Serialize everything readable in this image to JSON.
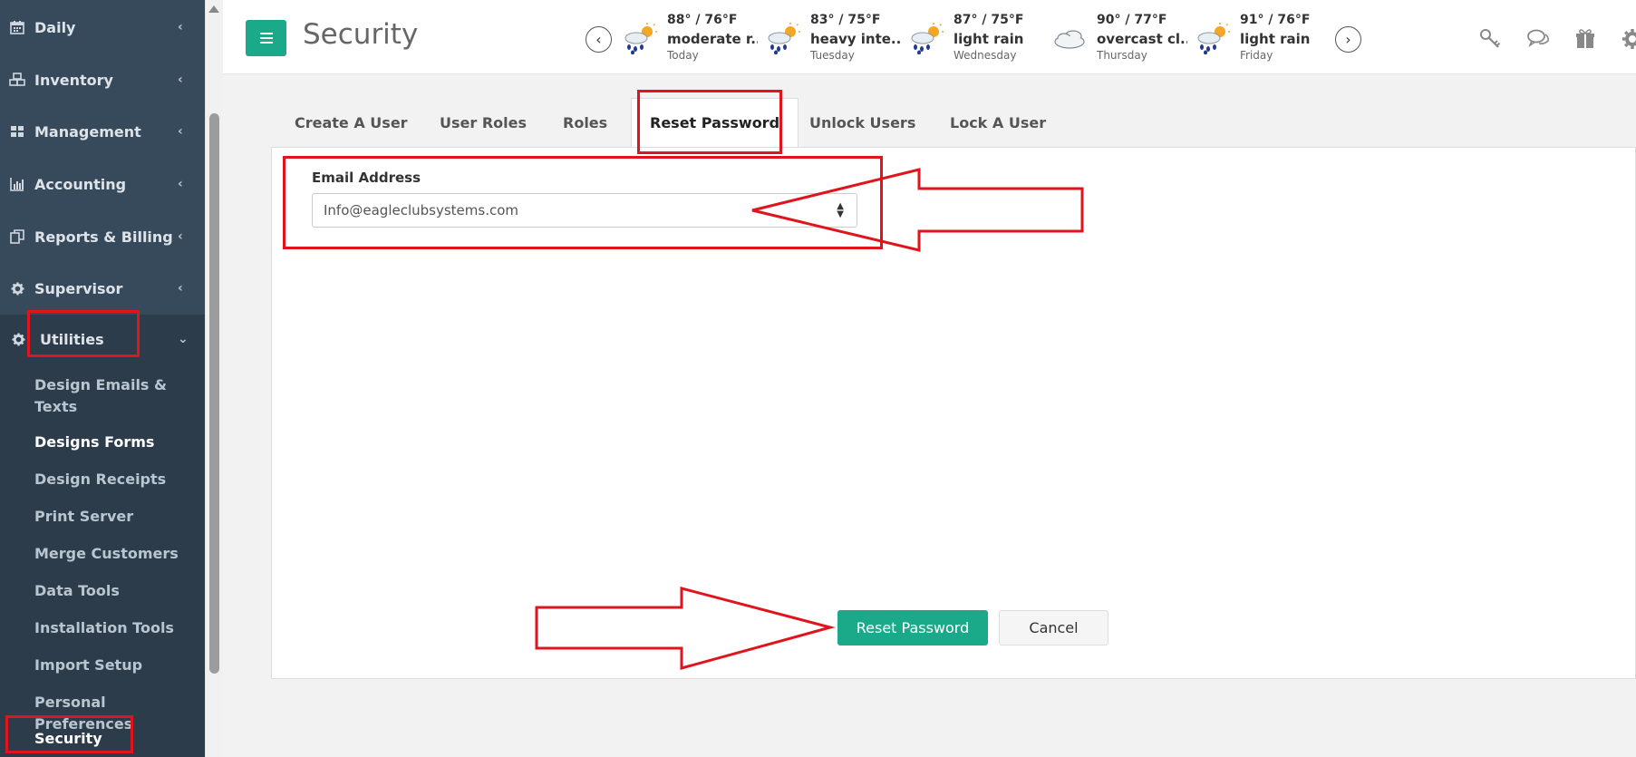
{
  "sidebar": {
    "items": [
      {
        "label": "Daily",
        "icon": "calendar-icon"
      },
      {
        "label": "Inventory",
        "icon": "boxes-icon"
      },
      {
        "label": "Management",
        "icon": "grid-icon"
      },
      {
        "label": "Accounting",
        "icon": "bar-chart-icon"
      },
      {
        "label": "Reports & Billing",
        "icon": "copy-icon"
      },
      {
        "label": "Supervisor",
        "icon": "gear-icon"
      },
      {
        "label": "Utilities",
        "icon": "gear-icon"
      }
    ],
    "submenu": [
      {
        "label": "Design Emails & Texts"
      },
      {
        "label": "Designs Forms"
      },
      {
        "label": "Design Receipts"
      },
      {
        "label": "Print Server"
      },
      {
        "label": "Merge Customers"
      },
      {
        "label": "Data Tools"
      },
      {
        "label": "Installation Tools"
      },
      {
        "label": "Import Setup"
      },
      {
        "label": "Personal Preferences"
      },
      {
        "label": "Security"
      }
    ]
  },
  "header": {
    "title": "Security",
    "weather": [
      {
        "temp": "88° / 76°F",
        "desc": "moderate r...",
        "day": "Today"
      },
      {
        "temp": "83° / 75°F",
        "desc": "heavy inte...",
        "day": "Tuesday"
      },
      {
        "temp": "87° / 75°F",
        "desc": "light rain",
        "day": "Wednesday"
      },
      {
        "temp": "90° / 77°F",
        "desc": "overcast cl...",
        "day": "Thursday"
      },
      {
        "temp": "91° / 76°F",
        "desc": "light rain",
        "day": "Friday"
      }
    ]
  },
  "tabs": [
    {
      "label": "Create A User"
    },
    {
      "label": "User Roles"
    },
    {
      "label": "Roles"
    },
    {
      "label": "Reset Password"
    },
    {
      "label": "Unlock Users"
    },
    {
      "label": "Lock A User"
    }
  ],
  "form": {
    "email_label": "Email Address",
    "email_value": "Info@eagleclubsystems.com",
    "reset_label": "Reset Password",
    "cancel_label": "Cancel"
  },
  "colors": {
    "accent": "#1aaa8a",
    "sidebar": "#374a5c",
    "annotation": "#e0141c"
  }
}
